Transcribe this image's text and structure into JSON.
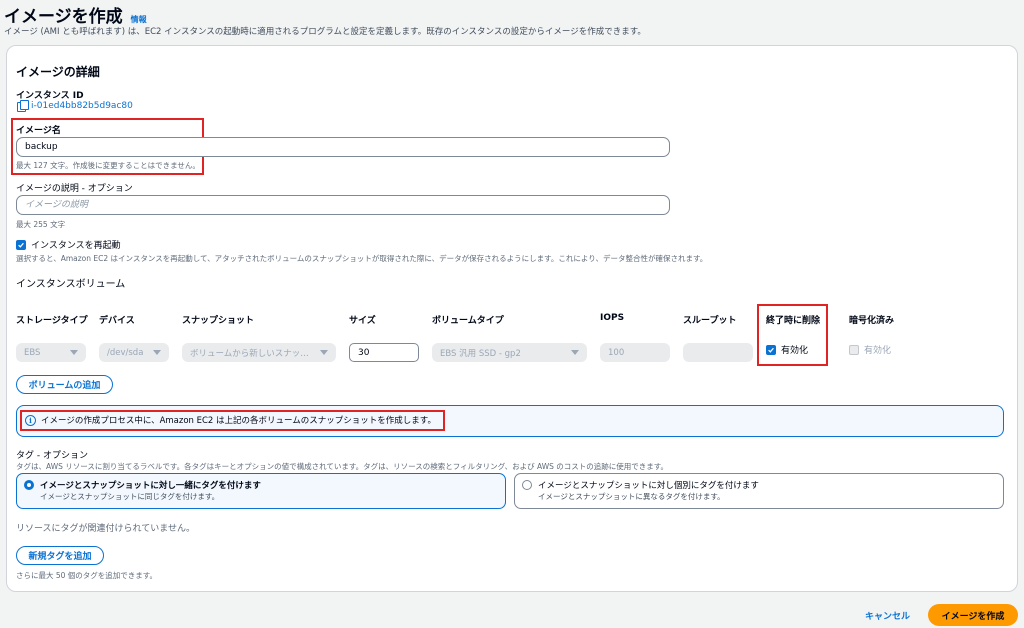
{
  "page": {
    "title": "イメージを作成",
    "info_link": "情報",
    "description": "イメージ (AMI とも呼ばれます) は、EC2 インスタンスの起動時に適用されるプログラムと設定を定義します。既存のインスタンスの設定からイメージを作成できます。"
  },
  "details": {
    "heading": "イメージの詳細",
    "instance_id_label": "インスタンス ID",
    "instance_id_value": "i-01ed4bb82b5d9ac80",
    "image_name_label": "イメージ名",
    "image_name_value": "backup",
    "image_name_hint": "最大 127 文字。作成後に変更することはできません。",
    "image_desc_label": "イメージの説明 - オプション",
    "image_desc_placeholder": "イメージの説明",
    "image_desc_hint": "最大 255 文字",
    "reboot_label": "インスタンスを再起動",
    "reboot_hint": "選択すると、Amazon EC2 はインスタンスを再起動して、アタッチされたボリュームのスナップショットが取得された際に、データが保存されるようにします。これにより、データ整合性が確保されます。"
  },
  "volumes": {
    "heading": "インスタンスボリューム",
    "columns": {
      "storage_type": "ストレージタイプ",
      "device": "デバイス",
      "snapshot": "スナップショット",
      "size": "サイズ",
      "volume_type": "ボリュームタイプ",
      "iops": "IOPS",
      "throughput": "スループット",
      "delete_on_termination": "終了時に削除",
      "encrypted": "暗号化済み"
    },
    "row": {
      "storage_type": "EBS",
      "device": "/dev/sda",
      "snapshot": "ボリュームから新しいスナップショット",
      "size": "30",
      "volume_type": "EBS 汎用 SSD - gp2",
      "iops": "100",
      "throughput": "",
      "delete_label": "有効化",
      "encrypted_label": "有効化"
    },
    "add_button": "ボリュームの追加",
    "info_message": "イメージの作成プロセス中に、Amazon EC2 は上記の各ボリュームのスナップショットを作成します。"
  },
  "tags": {
    "heading": "タグ - オプション",
    "description": "タグは、AWS リソースに割り当てるラベルです。各タグはキーとオプションの値で構成されています。タグは、リソースの検索とフィルタリング、および AWS のコストの追跡に使用できます。",
    "option1_title": "イメージとスナップショットに対し一緒にタグを付けます",
    "option1_desc": "イメージとスナップショットに同じタグを付けます。",
    "option2_title": "イメージとスナップショットに対し個別にタグを付けます",
    "option2_desc": "イメージとスナップショットに異なるタグを付けます。",
    "no_tags": "リソースにタグが関連付けられていません。",
    "add_button": "新規タグを追加",
    "add_hint": "さらに最大 50 個のタグを追加できます。"
  },
  "footer": {
    "cancel": "キャンセル",
    "create": "イメージを作成"
  },
  "colors": {
    "accent": "#0972d3",
    "primary_button": "#ff9900",
    "highlight": "#e02424"
  }
}
